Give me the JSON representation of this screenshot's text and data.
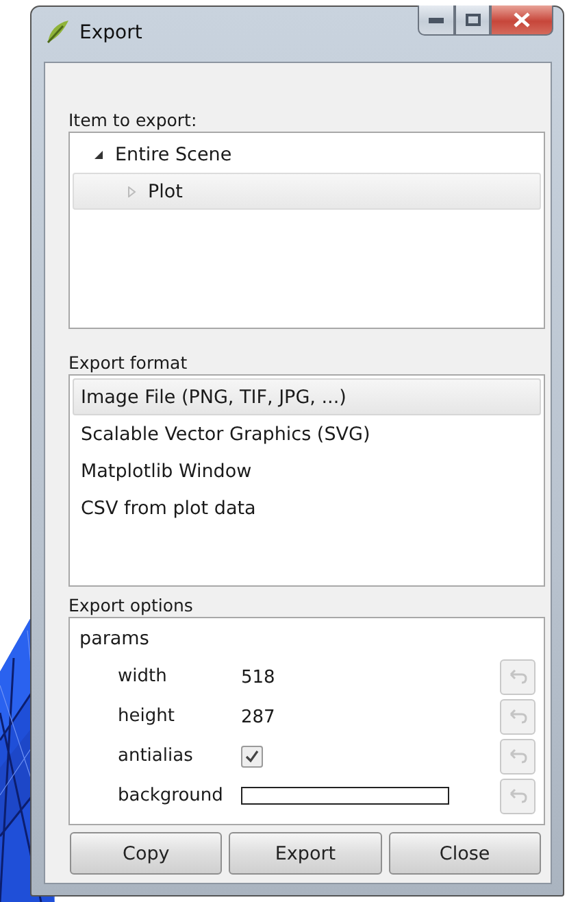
{
  "window": {
    "title": "Export"
  },
  "item_section": {
    "label": "Item to export:",
    "tree": [
      {
        "label": "Entire Scene",
        "expanded": true,
        "selected": false,
        "children": [
          {
            "label": "Plot",
            "expanded": false,
            "selected": true
          }
        ]
      }
    ]
  },
  "format_section": {
    "label": "Export format",
    "formats": [
      {
        "label": "Image File (PNG, TIF, JPG, ...)",
        "selected": true
      },
      {
        "label": "Scalable Vector Graphics (SVG)",
        "selected": false
      },
      {
        "label": "Matplotlib Window",
        "selected": false
      },
      {
        "label": "CSV from plot data",
        "selected": false
      }
    ]
  },
  "options_section": {
    "label": "Export options",
    "group": "params",
    "params": [
      {
        "name": "width",
        "kind": "text",
        "value": "518"
      },
      {
        "name": "height",
        "kind": "text",
        "value": "287"
      },
      {
        "name": "antialias",
        "kind": "checkbox",
        "checked": true
      },
      {
        "name": "background",
        "kind": "color",
        "color": "#ffffff"
      }
    ]
  },
  "buttons": [
    "Copy",
    "Export",
    "Close"
  ]
}
